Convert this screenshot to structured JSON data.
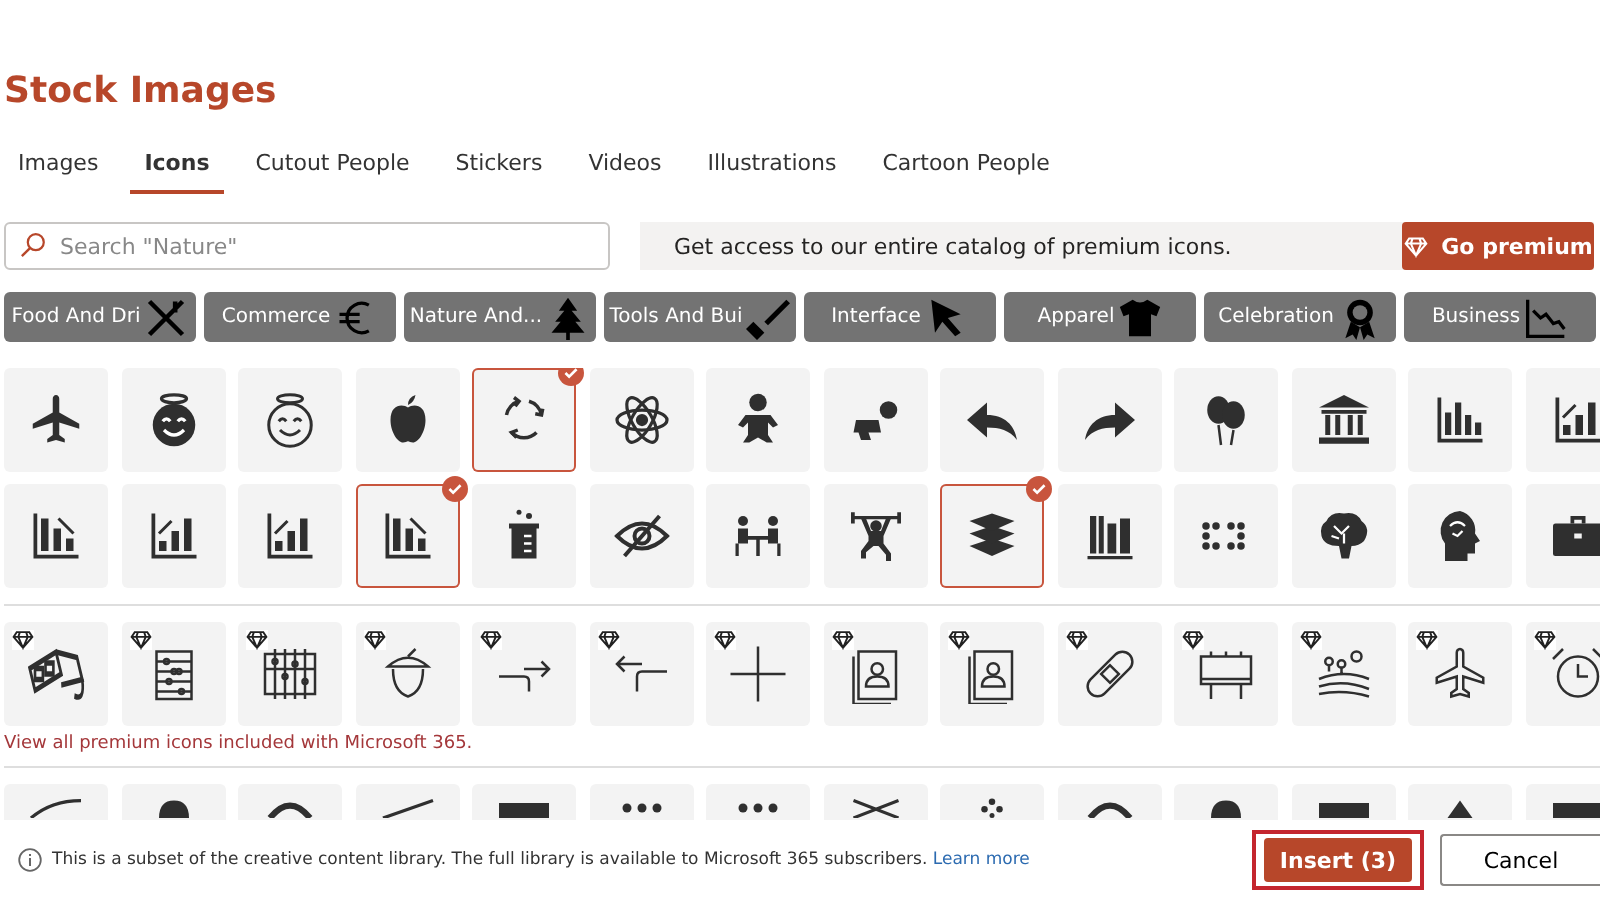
{
  "title": "Stock Images",
  "tabs": [
    {
      "label": "Images",
      "selected": false
    },
    {
      "label": "Icons",
      "selected": true
    },
    {
      "label": "Cutout People",
      "selected": false
    },
    {
      "label": "Stickers",
      "selected": false
    },
    {
      "label": "Videos",
      "selected": false
    },
    {
      "label": "Illustrations",
      "selected": false
    },
    {
      "label": "Cartoon People",
      "selected": false
    }
  ],
  "search": {
    "placeholder": "Search \"Nature\""
  },
  "promo": {
    "text": "Get access to our entire catalog of premium icons.",
    "button": "Go premium"
  },
  "categories": [
    {
      "label": "Food And Dri"
    },
    {
      "label": "Commerce"
    },
    {
      "label": "Nature And..."
    },
    {
      "label": "Tools And Bui"
    },
    {
      "label": "Interface"
    },
    {
      "label": "Apparel"
    },
    {
      "label": "Celebration"
    },
    {
      "label": "Business"
    }
  ],
  "rows": [
    {
      "tiles": [
        {
          "selected": false,
          "premium": false
        },
        {
          "selected": false,
          "premium": false
        },
        {
          "selected": false,
          "premium": false
        },
        {
          "selected": false,
          "premium": false
        },
        {
          "selected": true,
          "premium": false
        },
        {
          "selected": false,
          "premium": false
        },
        {
          "selected": false,
          "premium": false
        },
        {
          "selected": false,
          "premium": false
        },
        {
          "selected": false,
          "premium": false
        },
        {
          "selected": false,
          "premium": false
        },
        {
          "selected": false,
          "premium": false
        },
        {
          "selected": false,
          "premium": false
        },
        {
          "selected": false,
          "premium": false
        },
        {
          "selected": false,
          "premium": false
        }
      ]
    },
    {
      "tiles": [
        {
          "selected": false,
          "premium": false
        },
        {
          "selected": false,
          "premium": false
        },
        {
          "selected": false,
          "premium": false
        },
        {
          "selected": true,
          "premium": false
        },
        {
          "selected": false,
          "premium": false
        },
        {
          "selected": false,
          "premium": false
        },
        {
          "selected": false,
          "premium": false
        },
        {
          "selected": false,
          "premium": false
        },
        {
          "selected": true,
          "premium": false
        },
        {
          "selected": false,
          "premium": false
        },
        {
          "selected": false,
          "premium": false
        },
        {
          "selected": false,
          "premium": false
        },
        {
          "selected": false,
          "premium": false
        },
        {
          "selected": false,
          "premium": false
        }
      ]
    },
    {
      "tiles": [
        {
          "selected": false,
          "premium": true
        },
        {
          "selected": false,
          "premium": true
        },
        {
          "selected": false,
          "premium": true
        },
        {
          "selected": false,
          "premium": true
        },
        {
          "selected": false,
          "premium": true
        },
        {
          "selected": false,
          "premium": true
        },
        {
          "selected": false,
          "premium": true
        },
        {
          "selected": false,
          "premium": true
        },
        {
          "selected": false,
          "premium": true
        },
        {
          "selected": false,
          "premium": true
        },
        {
          "selected": false,
          "premium": true
        },
        {
          "selected": false,
          "premium": true
        },
        {
          "selected": false,
          "premium": true
        },
        {
          "selected": false,
          "premium": true
        }
      ],
      "link": "View all premium icons included with Microsoft 365."
    },
    {
      "tiles": [
        {
          "selected": false,
          "premium": false
        },
        {
          "selected": false,
          "premium": false
        },
        {
          "selected": false,
          "premium": false
        },
        {
          "selected": false,
          "premium": false
        },
        {
          "selected": false,
          "premium": false
        },
        {
          "selected": false,
          "premium": false
        },
        {
          "selected": false,
          "premium": false
        },
        {
          "selected": false,
          "premium": false
        },
        {
          "selected": false,
          "premium": false
        },
        {
          "selected": false,
          "premium": false
        },
        {
          "selected": false,
          "premium": false
        },
        {
          "selected": false,
          "premium": false
        },
        {
          "selected": false,
          "premium": false
        },
        {
          "selected": false,
          "premium": false
        }
      ]
    }
  ],
  "footer": {
    "note": "This is a subset of the creative content library. The full library is available to Microsoft 365 subscribers.",
    "link": "Learn more",
    "insert": "Insert (3)",
    "cancel": "Cancel"
  }
}
